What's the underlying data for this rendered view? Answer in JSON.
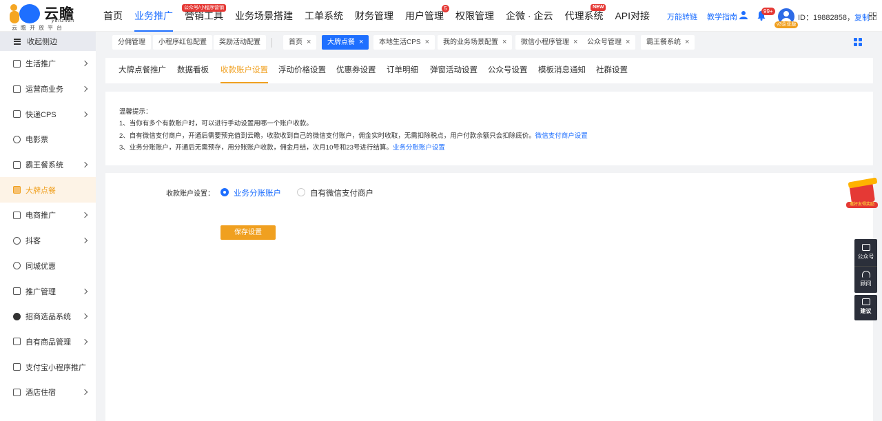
{
  "header": {
    "brand": "云瞻",
    "brand_sub": "yunzhan",
    "slogan": "云瞻开放平台",
    "nav": [
      {
        "label": "首页"
      },
      {
        "label": "业务推广",
        "active": true
      },
      {
        "label": "营销工具",
        "badge": "公众号/小程序营销"
      },
      {
        "label": "业务场景搭建"
      },
      {
        "label": "工单系统"
      },
      {
        "label": "财务管理"
      },
      {
        "label": "用户管理",
        "count": "5"
      },
      {
        "label": "权限管理"
      },
      {
        "label": "企微 · 企云"
      },
      {
        "label": "代理系统",
        "new": "NEW"
      },
      {
        "label": "API对接"
      }
    ],
    "links": [
      "万能转链",
      "教学指南"
    ],
    "bell_count": "99+",
    "vip_badge": "v3企业版",
    "user_id_text": "ID：19882858，",
    "copy_label": "复制"
  },
  "sidebar": {
    "collapse_label": "收起侧边",
    "items": [
      {
        "label": "生活推广",
        "icon": "life-icon",
        "chevron": true
      },
      {
        "label": "运营商业务",
        "icon": "operator-icon",
        "chevron": true
      },
      {
        "label": "快递CPS",
        "icon": "truck-icon",
        "chevron": true
      },
      {
        "label": "电影票",
        "icon": "film-icon",
        "chevron": false
      },
      {
        "label": "霸王餐系统",
        "icon": "meal-icon",
        "chevron": true
      },
      {
        "label": "大牌点餐",
        "icon": "restaurant-icon",
        "chevron": false,
        "active": true
      },
      {
        "label": "电商推广",
        "icon": "shop-icon",
        "chevron": true
      },
      {
        "label": "抖客",
        "icon": "douyin-icon",
        "chevron": true
      },
      {
        "label": "同城优惠",
        "icon": "location-icon",
        "chevron": false
      },
      {
        "label": "推广管理",
        "icon": "briefcase-icon",
        "chevron": true
      },
      {
        "label": "招商选品系统",
        "icon": "target-icon",
        "chevron": true
      },
      {
        "label": "自有商品管理",
        "icon": "bag-icon",
        "chevron": true
      },
      {
        "label": "支付宝小程序推广",
        "icon": "alipay-icon",
        "chevron": false
      },
      {
        "label": "酒店住宿",
        "icon": "hotel-icon",
        "chevron": true
      }
    ]
  },
  "tabs_left": [
    "分佣管理",
    "小程序红包配置",
    "奖励活动配置"
  ],
  "tabs_right": [
    {
      "label": "首页"
    },
    {
      "label": "大牌点餐",
      "active": true
    },
    {
      "label": "本地生活CPS"
    },
    {
      "label": "我的业务场景配置"
    },
    {
      "label": "微信小程序管理"
    },
    {
      "label": "公众号管理"
    },
    {
      "label": "霸王餐系统"
    }
  ],
  "subtabs": [
    {
      "label": "大牌点餐推广"
    },
    {
      "label": "数据看板"
    },
    {
      "label": "收款账户设置",
      "active": true
    },
    {
      "label": "浮动价格设置"
    },
    {
      "label": "优惠券设置"
    },
    {
      "label": "订单明细"
    },
    {
      "label": "弹窗活动设置"
    },
    {
      "label": "公众号设置"
    },
    {
      "label": "模板消息通知"
    },
    {
      "label": "社群设置"
    }
  ],
  "notice": {
    "title": "温馨提示：",
    "line1": "1、当你有多个有款账户时，可以进行手动设置用哪一个账户收款。",
    "line2": "2、自有微信支付商户，开通后需要预充值到云瞻，收款收到自己的微信支付账户，佣金实时收取，无需扣除税点，用户付款余额只会扣除底价。",
    "line2_link": "微信支付商户设置",
    "line3": "3、业务分账账户，开通后无需预存，用分账账户收款，佣金月结，次月10号和23号进行结算。",
    "line3_link": "业务分账账户设置"
  },
  "form": {
    "label": "收款账户设置：",
    "option1": "业务分账账户",
    "option2": "自有微信支付商户",
    "selected": 1,
    "save_label": "保存设置"
  },
  "float": {
    "redpacket_label": "邀好友得奖励",
    "wechat_label": "公众号",
    "consult_label": "顾问",
    "suggest_label": "建议"
  }
}
